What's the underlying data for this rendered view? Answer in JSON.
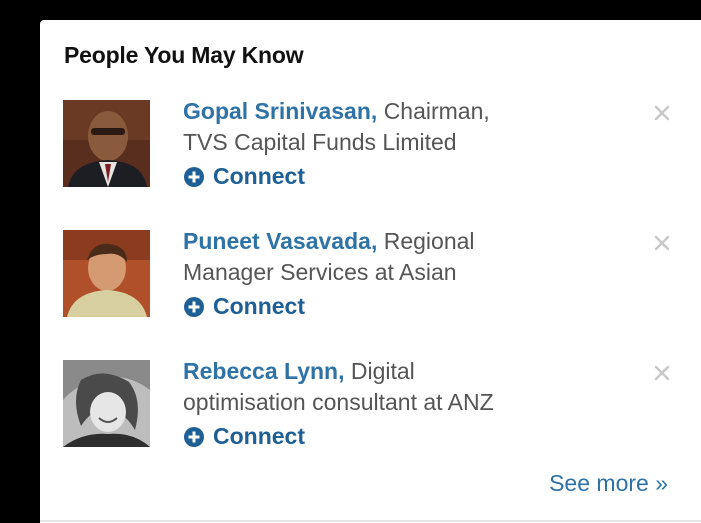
{
  "widget": {
    "title": "People You May Know",
    "see_more_label": "See more »"
  },
  "people": [
    {
      "name": "Gopal Srinivasan,",
      "headline": "Chairman,",
      "headline_line2": "TVS Capital Funds Limited",
      "connect_label": "Connect"
    },
    {
      "name": "Puneet Vasavada,",
      "headline": "Regional",
      "headline_line2": "Manager Services at Asian",
      "connect_label": "Connect"
    },
    {
      "name": "Rebecca Lynn,",
      "headline": "Digital",
      "headline_line2": "optimisation consultant at ANZ",
      "connect_label": "Connect"
    }
  ],
  "icons": {
    "connect": "plus-circle-icon",
    "dismiss": "close-icon"
  },
  "colors": {
    "link": "#2f73a6",
    "connect": "#1e5f96",
    "text": "#555555"
  }
}
